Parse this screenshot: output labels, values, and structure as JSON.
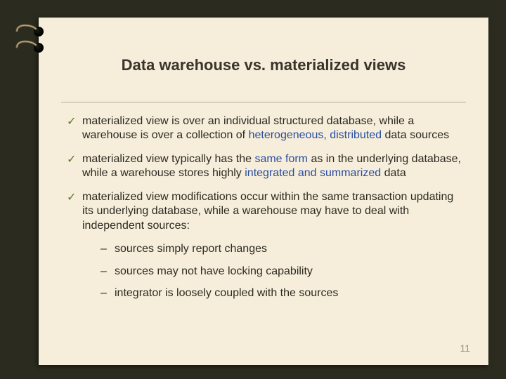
{
  "title": "Data warehouse vs. materialized views",
  "bullets": {
    "b1": {
      "tick": "✓",
      "seg1": "materialized view is over an individual structured database, while a warehouse is  over a collection of ",
      "kw1": "heterogeneous, distributed",
      "seg2": " data sources"
    },
    "b2": {
      "tick": "✓",
      "seg1": "materialized view typically has the ",
      "kw1": "same form",
      "seg2": " as in the underlying database, while a warehouse stores highly ",
      "kw2": "integrated and summarized",
      "seg3": " data"
    },
    "b3": {
      "tick": "✓",
      "seg1": "materialized view modifications occur within the same transaction updating its underlying database, while a warehouse may have to deal with independent sources:"
    }
  },
  "sub": {
    "dash": "–",
    "s1": "sources simply report changes",
    "s2": "sources may not have locking capability",
    "s3": "integrator is loosely coupled with the sources"
  },
  "page_number": "11"
}
